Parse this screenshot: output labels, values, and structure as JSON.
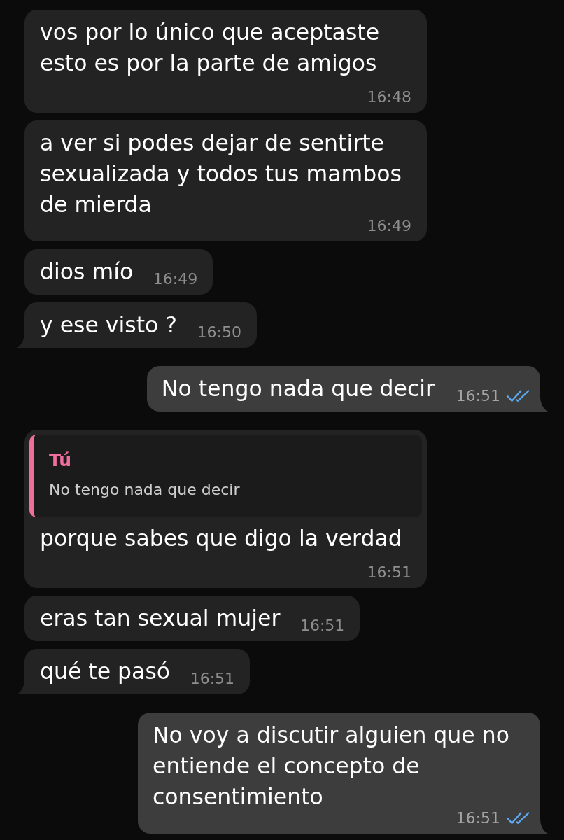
{
  "messages": [
    {
      "kind": "incoming",
      "text": "vos por lo único que aceptaste esto es por la parte de amigos",
      "time": "16:48"
    },
    {
      "kind": "incoming",
      "text": "a ver si podes dejar de sentirte sexualizada y todos tus mambos de mierda",
      "time": "16:49"
    },
    {
      "kind": "incoming",
      "text": "dios mío",
      "time": "16:49"
    },
    {
      "kind": "incoming",
      "text": "y ese visto ?",
      "time": "16:50"
    },
    {
      "kind": "outgoing",
      "text": "No tengo nada que decir",
      "time": "16:51",
      "read": true
    },
    {
      "kind": "incoming",
      "reply_to": {
        "author": "Tú",
        "text": "No tengo nada que decir"
      },
      "text": "porque sabes que digo la verdad",
      "time": "16:51"
    },
    {
      "kind": "incoming",
      "text": "eras tan sexual mujer",
      "time": "16:51"
    },
    {
      "kind": "incoming",
      "text": "qué te pasó",
      "time": "16:51"
    },
    {
      "kind": "outgoing",
      "text": "No voy a discutir alguien que no entiende el concepto de consentimiento",
      "time": "16:51",
      "read": true
    }
  ]
}
